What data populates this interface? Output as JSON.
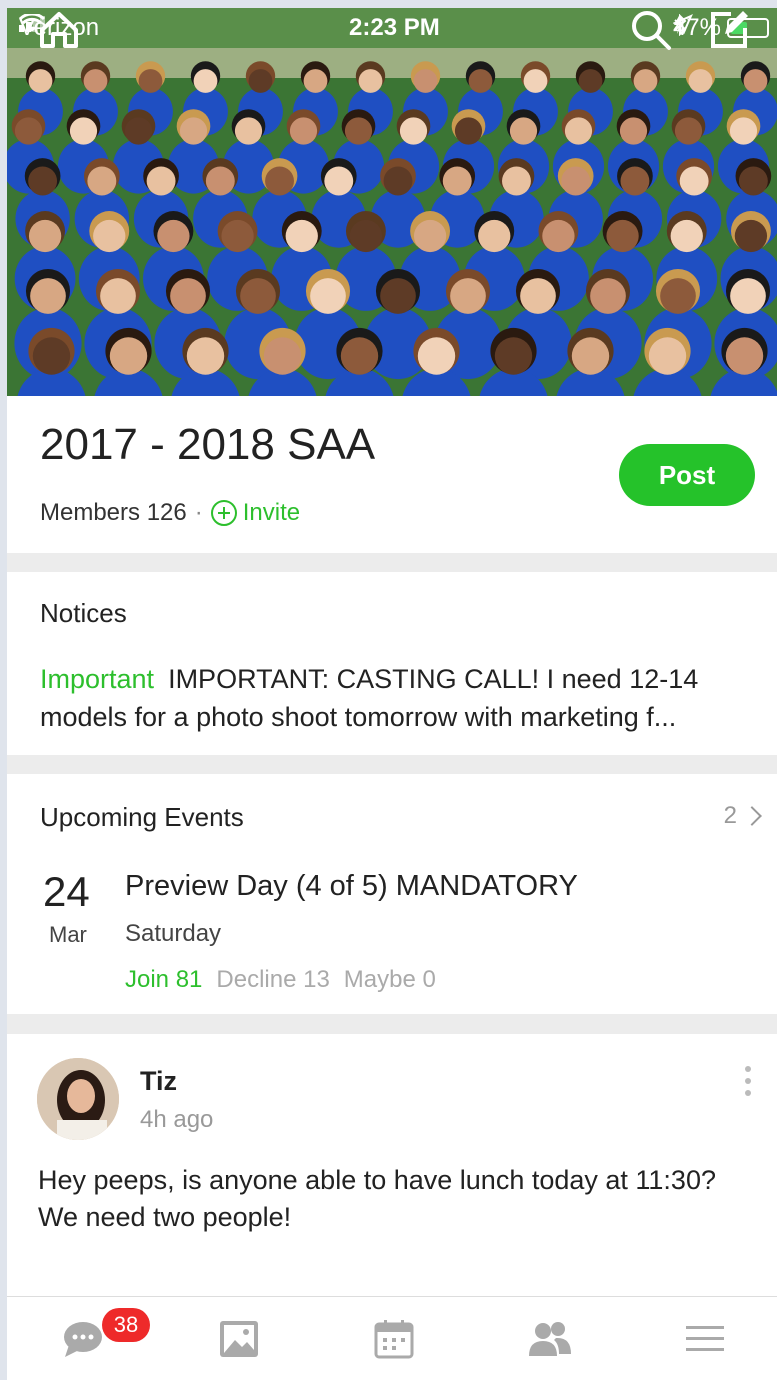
{
  "status_bar": {
    "carrier": "Verizon",
    "time": "2:23 PM",
    "battery": "47%",
    "battery_level": 0.47
  },
  "group": {
    "title": "2017 - 2018 SAA",
    "members_label": "Members 126",
    "invite_label": "Invite",
    "post_label": "Post"
  },
  "notices": {
    "title": "Notices",
    "tag": "Important",
    "text": "IMPORTANT: CASTING CALL! I need 12-14 models for a photo shoot tomorrow with marketing f..."
  },
  "events": {
    "title": "Upcoming Events",
    "count": "2",
    "items": [
      {
        "day": "24",
        "month": "Mar",
        "name": "Preview Day (4 of 5) MANDATORY",
        "weekday": "Saturday",
        "join": "Join 81",
        "decline": "Decline 13",
        "maybe": "Maybe 0"
      }
    ]
  },
  "post": {
    "author": "Tiz",
    "time": "4h ago",
    "body": "Hey peeps, is anyone able to have lunch today at 11:30?\nWe need two people!"
  },
  "tabbar": {
    "chat_badge": "38",
    "tabs": [
      "chat-icon",
      "photos-icon",
      "calendar-icon",
      "members-icon",
      "menu-icon"
    ]
  },
  "colors": {
    "accent_green": "#25c22a",
    "badge_red": "#ee2a2a",
    "shirt_blue": "#1f4fc2"
  }
}
